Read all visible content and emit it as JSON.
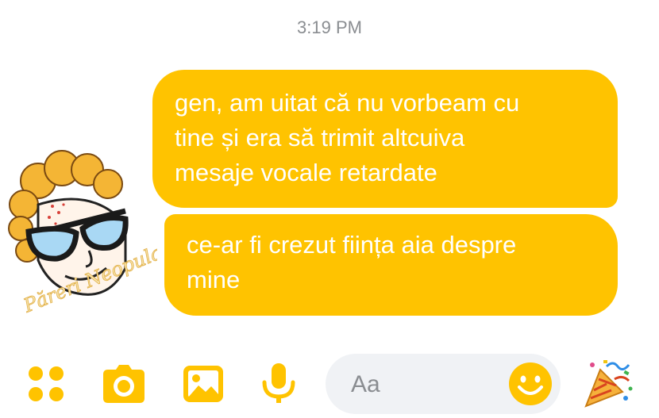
{
  "conversation": {
    "timestamp": "3:19 PM",
    "messages": [
      {
        "lines": [
          "gen, am uitat că nu vorbeam cu",
          "tine și era să trimit altcuiva",
          "mesaje vocale retardate"
        ]
      },
      {
        "lines": [
          "ce-ar fi crezut ființa aia despre",
          "mine"
        ]
      }
    ],
    "sticker": {
      "icon": "cartoon-avatar-sticker",
      "watermark": "Păreri Neopulare"
    }
  },
  "composer": {
    "placeholder": "Aa",
    "icons": {
      "apps": "apps-grid-icon",
      "camera": "camera-icon",
      "gallery": "gallery-icon",
      "mic": "microphone-icon",
      "emoji": "smiley-icon",
      "party": "party-popper-icon"
    }
  },
  "colors": {
    "accent": "#ffc300",
    "bubble_text": "#ffffff",
    "timestamp_text": "#8a8d91",
    "input_background": "#f0f2f5"
  }
}
